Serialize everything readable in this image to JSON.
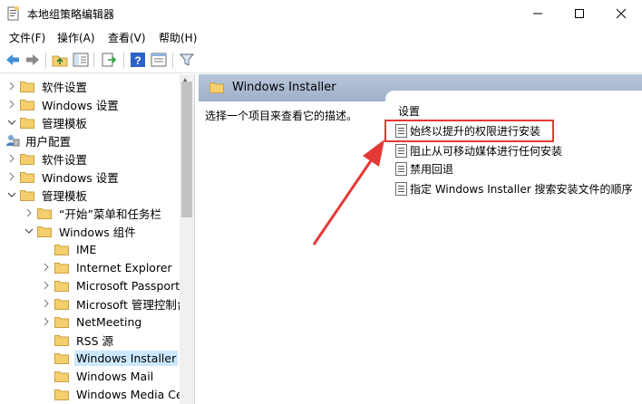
{
  "window": {
    "title": "本地组策略编辑器",
    "minimize_icon": "minimize-icon",
    "maximize_icon": "maximize-icon",
    "close_icon": "close-icon"
  },
  "menu": [
    "文件(F)",
    "操作(A)",
    "查看(V)",
    "帮助(H)"
  ],
  "toolbar": {
    "icons": [
      "back-arrow-icon",
      "forward-arrow-icon",
      "up-folder-icon",
      "show-hide-tree-icon",
      "export-list-icon",
      "help-icon",
      "properties-icon",
      "filter-icon"
    ]
  },
  "tree": [
    {
      "label": "软件设置",
      "indent": 0
    },
    {
      "label": "Windows 设置",
      "indent": 0
    },
    {
      "label": "管理模板",
      "indent": 0
    },
    {
      "label": "用户配置",
      "indent": -1
    },
    {
      "label": "软件设置",
      "indent": 0
    },
    {
      "label": "Windows 设置",
      "indent": 0
    },
    {
      "label": "管理模板",
      "indent": 0
    },
    {
      "label": "“开始”菜单和任务栏",
      "indent": 1
    },
    {
      "label": "Windows 组件",
      "indent": 1
    },
    {
      "label": "IME",
      "indent": 2
    },
    {
      "label": "Internet Explorer",
      "indent": 2
    },
    {
      "label": "Microsoft Passport",
      "indent": 2
    },
    {
      "label": "Microsoft 管理控制台",
      "indent": 2
    },
    {
      "label": "NetMeeting",
      "indent": 2
    },
    {
      "label": "RSS 源",
      "indent": 2
    },
    {
      "label": "Windows Installer",
      "indent": 2
    },
    {
      "label": "Windows Mail",
      "indent": 2
    },
    {
      "label": "Windows Media Center",
      "indent": 2
    }
  ],
  "right": {
    "header": "Windows Installer",
    "description": "选择一个项目来查看它的描述。",
    "column": "设置",
    "settings": [
      "始终以提升的权限进行安装",
      "阻止从可移动媒体进行任何安装",
      "禁用回退",
      "指定 Windows Installer 搜索安装文件的顺序"
    ]
  },
  "colors": {
    "selection": "#cce8ff",
    "header_bg": "#a9b8cf",
    "highlight": "#e53935",
    "arrow": "#e53935",
    "folder": "#f5cf6e"
  }
}
